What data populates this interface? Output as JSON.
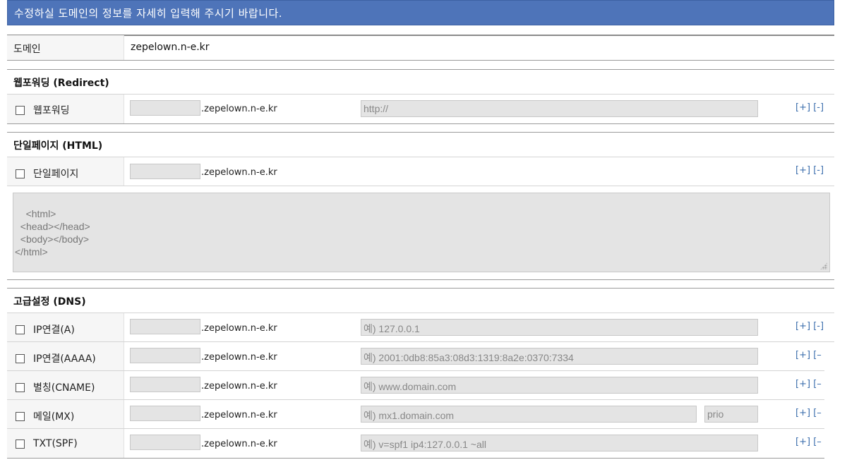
{
  "header": {
    "title": "수정하실 도메인의 정보를 자세히 입력해 주시기 바랍니다."
  },
  "domain": {
    "label": "도메인",
    "value": "zepelown.n-e.kr"
  },
  "suffix": ".zepelown.n-e.kr",
  "controls": {
    "add": "[+]",
    "remove": "[-]",
    "remove_cut": "[–"
  },
  "redirect": {
    "title": "웹포워딩 (Redirect)",
    "row": {
      "label": "웹포워딩",
      "placeholder": "http://"
    }
  },
  "single_page": {
    "title": "단일페이지 (HTML)",
    "row": {
      "label": "단일페이지"
    },
    "html_content": "<html>\n  <head></head>\n  <body></body>\n</html>"
  },
  "dns": {
    "title": "고급설정 (DNS)",
    "rows": [
      {
        "label": "IP연결(A)",
        "placeholder": "예) 127.0.0.1"
      },
      {
        "label": "IP연결(AAAA)",
        "placeholder": "예) 2001:0db8:85a3:08d3:1319:8a2e:0370:7334"
      },
      {
        "label": "별칭(CNAME)",
        "placeholder": "예) www.domain.com"
      },
      {
        "label": "메일(MX)",
        "placeholder": "예) mx1.domain.com",
        "prio_placeholder": "prio"
      },
      {
        "label": "TXT(SPF)",
        "placeholder": "예) v=spf1 ip4:127.0.0.1 ~all"
      }
    ]
  }
}
